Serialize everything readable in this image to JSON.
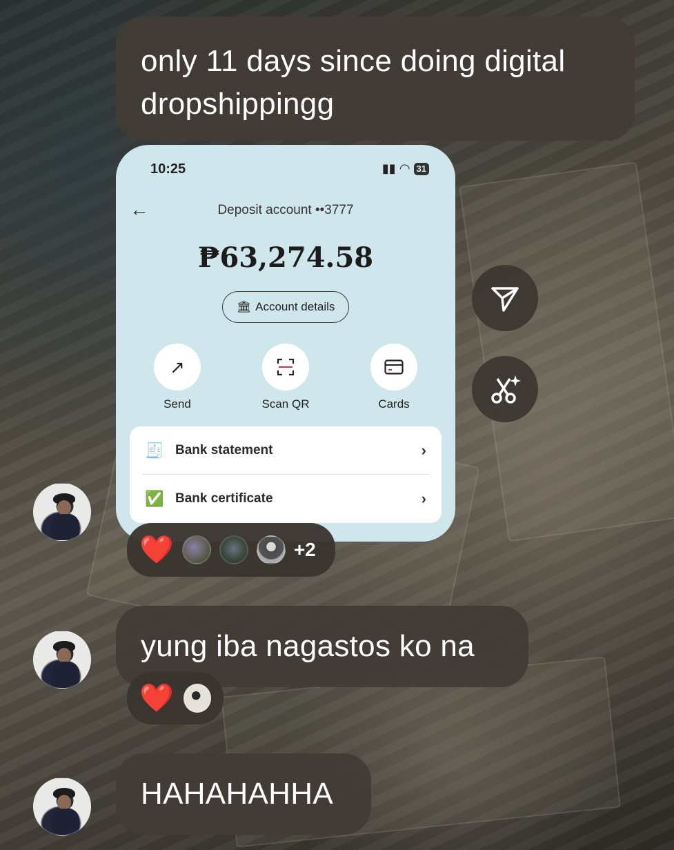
{
  "messages": [
    {
      "text": "only 11 days since doing digital dropshippingg"
    },
    {
      "text": "yung iba nagastos ko na"
    },
    {
      "text": "HAHAHAHHA"
    }
  ],
  "screenshot": {
    "status_time": "10:25",
    "battery": "31",
    "account_title": "Deposit account ••3777",
    "balance": "₱63,274.58",
    "account_details_label": "Account details",
    "actions": [
      {
        "label": "Send",
        "icon": "send-arrow-icon"
      },
      {
        "label": "Scan QR",
        "icon": "scan-qr-icon"
      },
      {
        "label": "Cards",
        "icon": "card-icon"
      }
    ],
    "list": [
      {
        "label": "Bank statement",
        "icon": "receipt-icon"
      },
      {
        "label": "Bank certificate",
        "icon": "certificate-icon"
      }
    ]
  },
  "reactions": {
    "first": {
      "emoji": "❤️",
      "extra_count": "+2"
    },
    "second": {
      "emoji": "❤️"
    }
  },
  "side_actions": [
    {
      "icon": "share-icon"
    },
    {
      "icon": "ai-edit-icon"
    }
  ]
}
